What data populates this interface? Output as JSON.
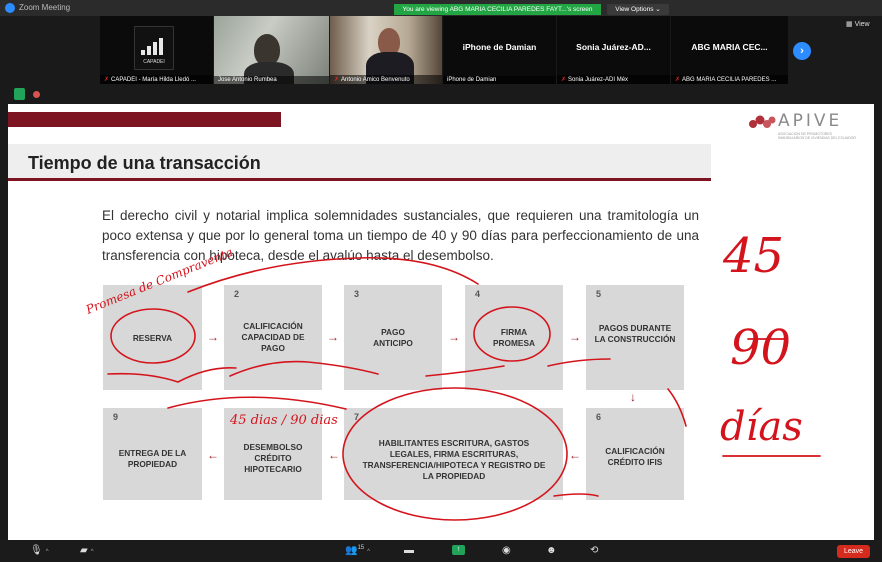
{
  "window": {
    "title": "Zoom Meeting"
  },
  "banner": {
    "text": "You are viewing ABG MARIA CECILIA PAREDES FAYT...'s screen",
    "view_options": "View Options ⌄"
  },
  "header_right": {
    "view_label": "View"
  },
  "gallery": [
    {
      "name": "CAPADEI - María Hilda Lledó ...",
      "muted": true,
      "kind": "logo",
      "logo_text": "CAPADEI"
    },
    {
      "name": "Jose Antonio Rumbea",
      "muted": false,
      "kind": "video"
    },
    {
      "name": "Antonio Amico Benvenuto",
      "muted": true,
      "kind": "video"
    },
    {
      "name": "iPhone de Damian",
      "muted": false,
      "kind": "name",
      "big": "iPhone de Damian"
    },
    {
      "name": "Sonia Juárez-ADI Méx",
      "muted": true,
      "kind": "name",
      "big": "Sonia Juárez-AD..."
    },
    {
      "name": "ABG MARIA CECILIA PAREDES ...",
      "muted": true,
      "kind": "name",
      "big": "ABG MARIA CEC..."
    }
  ],
  "slide": {
    "logo": {
      "word": "APIVE",
      "tagline": "ASOCIACION DE PROMOTORES INMOBILIARIOS DE VIVIENDAS DEL ECUADOR"
    },
    "title": "Tiempo de una transacción",
    "paragraph": "El derecho civil y notarial implica solemnidades sustanciales, que requieren una tramitología un poco extensa y que  por lo general toma un tiempo de 40 y 90 días para perfeccionamiento de una transferencia con hipoteca, desde el avalúo hasta el desembolso.",
    "steps": [
      {
        "num": "",
        "label": "RESERVA"
      },
      {
        "num": "2",
        "label": "CALIFICACIÓN CAPACIDAD DE PAGO"
      },
      {
        "num": "3",
        "label": "PAGO ANTICIPO"
      },
      {
        "num": "4",
        "label": "FIRMA PROMESA"
      },
      {
        "num": "5",
        "label": "PAGOS DURANTE LA CONSTRUCCIÓN"
      },
      {
        "num": "6",
        "label": "CALIFICACIÓN CRÉDITO IFIS"
      },
      {
        "num": "7",
        "label": "HABILITANTES ESCRITURA, GASTOS LEGALES, FIRMA ESCRITURAS, TRANSFERENCIA/HIPOTECA Y REGISTRO DE LA PROPIEDAD"
      },
      {
        "num": "",
        "label": "DESEMBOLSO CRÉDITO HIPOTECARIO"
      },
      {
        "num": "9",
        "label": "ENTREGA DE LA PROPIEDAD"
      }
    ],
    "annotations": {
      "big_start": "45",
      "big_end": "90",
      "big_unit": "días",
      "small_note": "45 dias / 90 dias",
      "side_note": "Promesa de Compraventa"
    }
  },
  "toolbar": {
    "participants_count": "15",
    "leave_label": "Leave"
  },
  "colors": {
    "accent_red": "#7d1421",
    "zoom_blue": "#2d8cff",
    "banner_green": "#21a643",
    "ink_red": "#d4141c"
  }
}
